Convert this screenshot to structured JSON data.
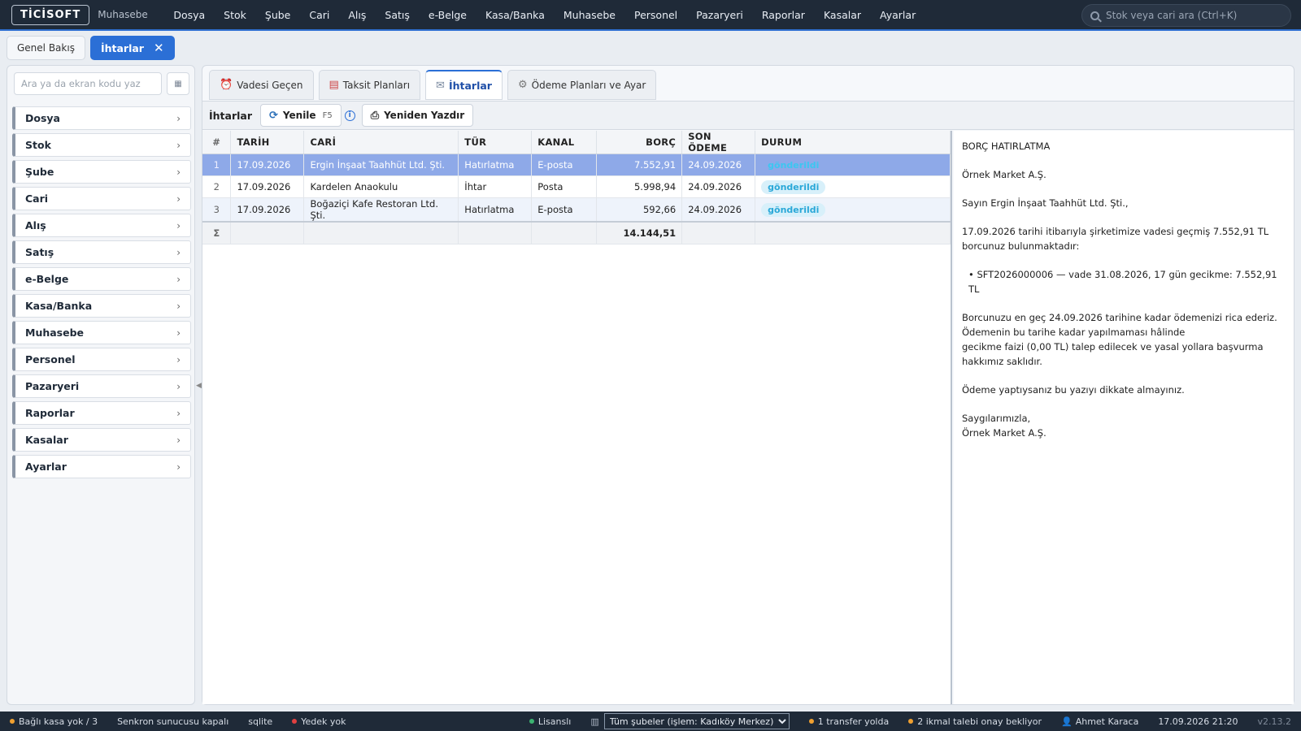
{
  "app": {
    "logo": "TİCİSOFT",
    "module": "Muhasebe"
  },
  "menu": [
    "Dosya",
    "Stok",
    "Şube",
    "Cari",
    "Alış",
    "Satış",
    "e-Belge",
    "Kasa/Banka",
    "Muhasebe",
    "Personel",
    "Pazaryeri",
    "Raporlar",
    "Kasalar",
    "Ayarlar"
  ],
  "search": {
    "placeholder": "Stok veya cari ara (Ctrl+K)"
  },
  "page_tabs": [
    {
      "label": "Genel Bakış",
      "active": false
    },
    {
      "label": "İhtarlar",
      "active": true
    }
  ],
  "sidebar": {
    "search_placeholder": "Ara ya da ekran kodu yaz",
    "items": [
      "Dosya",
      "Stok",
      "Şube",
      "Cari",
      "Alış",
      "Satış",
      "e-Belge",
      "Kasa/Banka",
      "Muhasebe",
      "Personel",
      "Pazaryeri",
      "Raporlar",
      "Kasalar",
      "Ayarlar"
    ]
  },
  "sub_tabs": [
    {
      "label": "Vadesi Geçen",
      "icon": "alarm-clock-icon"
    },
    {
      "label": "Taksit Planları",
      "icon": "calendar-icon"
    },
    {
      "label": "İhtarlar",
      "icon": "envelope-icon",
      "active": true
    },
    {
      "label": "Ödeme Planları ve Ayar",
      "icon": "gear-icon"
    }
  ],
  "toolbar": {
    "title": "İhtarlar",
    "refresh_label": "Yenile",
    "refresh_key": "F5",
    "reprint_label": "Yeniden Yazdır"
  },
  "table": {
    "columns": [
      "#",
      "TARİH",
      "CARİ",
      "TÜR",
      "KANAL",
      "BORÇ",
      "SON ÖDEME",
      "DURUM"
    ],
    "rows": [
      {
        "no": "1",
        "tarih": "17.09.2026",
        "cari": "Ergin İnşaat Taahhüt Ltd. Şti.",
        "tur": "Hatırlatma",
        "kanal": "E-posta",
        "borc": "7.552,91",
        "son_odeme": "24.09.2026",
        "durum": "gönderildi"
      },
      {
        "no": "2",
        "tarih": "17.09.2026",
        "cari": "Kardelen Anaokulu",
        "tur": "İhtar",
        "kanal": "Posta",
        "borc": "5.998,94",
        "son_odeme": "24.09.2026",
        "durum": "gönderildi"
      },
      {
        "no": "3",
        "tarih": "17.09.2026",
        "cari": "Boğaziçi Kafe Restoran Ltd. Şti.",
        "tur": "Hatırlatma",
        "kanal": "E-posta",
        "borc": "592,66",
        "son_odeme": "24.09.2026",
        "durum": "gönderildi"
      }
    ],
    "sum_symbol": "Σ",
    "sum_total": "14.144,51"
  },
  "preview": {
    "title": "BORÇ HATIRLATMA",
    "company": "Örnek Market A.Ş.",
    "salutation": "Sayın Ergin İnşaat Taahhüt Ltd. Şti.,",
    "para1": "17.09.2026 tarihi itibarıyla şirketimize vadesi geçmiş 7.552,91 TL borcunuz bulunmaktadır:",
    "bullet": "SFT2026000006 — vade 31.08.2026, 17 gün gecikme: 7.552,91 TL",
    "para2_line1": "Borcunuzu en geç 24.09.2026 tarihine kadar ödemenizi rica ederiz.",
    "para2_line2": "Ödemenin bu tarihe kadar yapılmaması hâlinde",
    "para2_line3": "gecikme faizi (0,00 TL) talep edilecek ve yasal yollara başvurma hakkımız saklıdır.",
    "para3": "Ödeme yaptıysanız bu yazıyı dikkate almayınız.",
    "closing": "Saygılarımızla,",
    "signature": "Örnek Market A.Ş."
  },
  "status": {
    "kasa": "Bağlı kasa yok / 3",
    "sync": "Senkron sunucusu kapalı",
    "db": "sqlite",
    "backup": "Yedek yok",
    "license": "Lisanslı",
    "branch_select": "Tüm şubeler (işlem: Kadıköy Merkez)",
    "transfer": "1 transfer yolda",
    "ikmal": "2 ikmal talebi onay bekliyor",
    "user": "Ahmet Karaca",
    "datetime": "17.09.2026 21:20",
    "version": "v2.13.2"
  },
  "colors": {
    "accent": "#2b6fd6",
    "topbar": "#1f2a38",
    "selected_row": "#8ea9e8",
    "status_orange": "#f0a030",
    "status_red": "#e04040",
    "status_green": "#3cb371"
  }
}
